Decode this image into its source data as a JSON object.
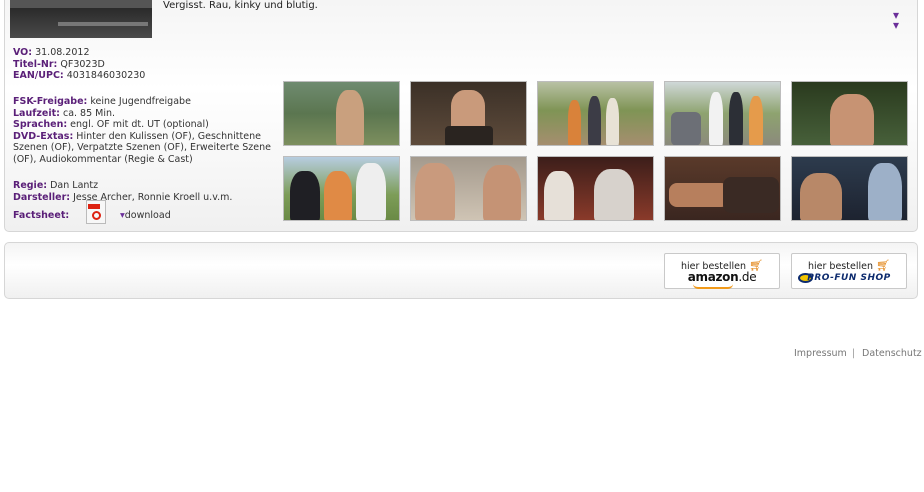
{
  "teaser_text": "Vergisst. Rau, kinky und blutig.",
  "details": {
    "vo": {
      "label": "VO:",
      "value": "31.08.2012"
    },
    "titel_nr": {
      "label": "Titel-Nr:",
      "value": "QF3023D"
    },
    "ean": {
      "label": "EAN/UPC:",
      "value": "4031846030230"
    },
    "fsk": {
      "label": "FSK-Freigabe:",
      "value": "keine Jugendfreigabe"
    },
    "laufzeit": {
      "label": "Laufzeit:",
      "value": "ca. 85 Min."
    },
    "sprachen": {
      "label": "Sprachen:",
      "value": "engl. OF mit dt. UT (optional)"
    },
    "extras": {
      "label": "DVD-Extas:",
      "value": "Hinter den Kulissen (OF), Geschnittene Szenen (OF), Verpatzte Szenen (OF), Erweiterte Szene (OF), Audiokommentar (Regie & Cast)"
    },
    "regie": {
      "label": "Regie:",
      "value": "Dan Lantz"
    },
    "darsteller": {
      "label": "Darsteller:",
      "value": "Jesse Archer, Ronnie Kroell u.v.m."
    },
    "factsheet": {
      "label": "Factsheet:",
      "download_label": "download"
    }
  },
  "order": {
    "amazon": {
      "label": "hier bestellen",
      "brand": "amazon",
      "brand_suffix": ".de"
    },
    "profun": {
      "label": "hier bestellen",
      "brand": "PRO-FUN SHOP"
    }
  },
  "footer": {
    "impressum": "Impressum",
    "separator": "|",
    "datenschutz": "Datenschutz"
  },
  "icons": {
    "expand": "double-chevron-down-icon",
    "pdf": "pdf-icon",
    "cart": "shopping-cart-icon"
  },
  "colors": {
    "label_purple": "#5a1f78",
    "chevron_purple": "#6b2f9a",
    "cart_orange": "#e07a00",
    "pdf_red": "#dd2211"
  }
}
